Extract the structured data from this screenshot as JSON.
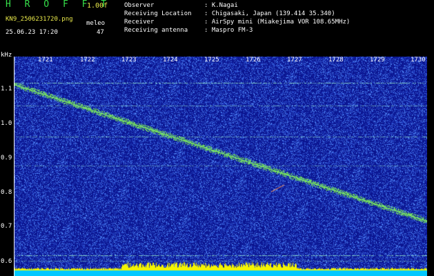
{
  "header": {
    "app_title": "H R O F F T",
    "version": "1.00f",
    "filename": "KN9_2506231720.png",
    "datetime": "25.06.23 17:20",
    "mode": "meleo",
    "count": "47"
  },
  "info": [
    {
      "label": "Observer",
      "value": ": K.Nagai"
    },
    {
      "label": "Receiving Location",
      "value": ": Chigasaki, Japan (139.414 35.340)"
    },
    {
      "label": "Receiver",
      "value": ": AirSpy mini (Miakejima VOR 108.65MHz)"
    },
    {
      "label": "Receiving antenna",
      "value": ": Maspro FM-3"
    }
  ],
  "axis": {
    "y_unit": "kHz",
    "y_labels": [
      "1.1",
      "1.0",
      "0.9",
      "0.8",
      "0.7",
      "0.6"
    ],
    "x_labels": [
      "1721",
      "1722",
      "1723",
      "1724",
      "1725",
      "1726",
      "1727",
      "1728",
      "1729",
      "1730"
    ]
  },
  "colors": {
    "background": "#0b1590",
    "noise_light": "#4a78ff",
    "signal": "#7ef05a",
    "bottom_bar": "#f4f400",
    "bottom_base": "#00c8ff",
    "title_green": "#36e04a",
    "yellow_text": "#e9e94a"
  }
}
